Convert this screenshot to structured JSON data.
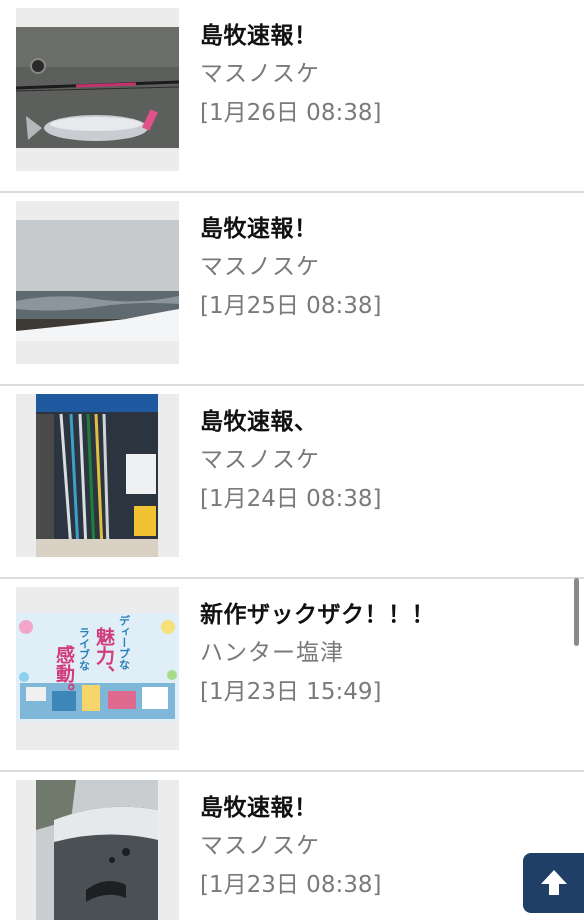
{
  "posts": [
    {
      "title": "島牧速報！",
      "author": "マスノスケ",
      "date": "[1月26日 08:38]",
      "thumb": "fish-rod-photo"
    },
    {
      "title": "島牧速報！",
      "author": "マスノスケ",
      "date": "[1月25日 08:38]",
      "thumb": "snowy-coast-photo"
    },
    {
      "title": "島牧速報、",
      "author": "マスノスケ",
      "date": "[1月24日 08:38]",
      "thumb": "rod-rack-photo"
    },
    {
      "title": "新作ザックザク！！！",
      "author": "ハンター塩津",
      "date": "[1月23日 15:49]",
      "thumb": "poster-image"
    },
    {
      "title": "島牧速報！",
      "author": "マスノスケ",
      "date": "[1月23日 08:38]",
      "thumb": "frosted-car-photo"
    }
  ],
  "poster_text": {
    "line1": "感動。",
    "line2": "ライブな",
    "line3": "魅力、",
    "line4": "ディープな"
  },
  "colors": {
    "title": "#111111",
    "meta": "#7a7a7a",
    "divider": "#dcdcdc",
    "to_top_bg": "#1f3f66"
  },
  "icons": {
    "to_top": "arrow-up-icon"
  }
}
